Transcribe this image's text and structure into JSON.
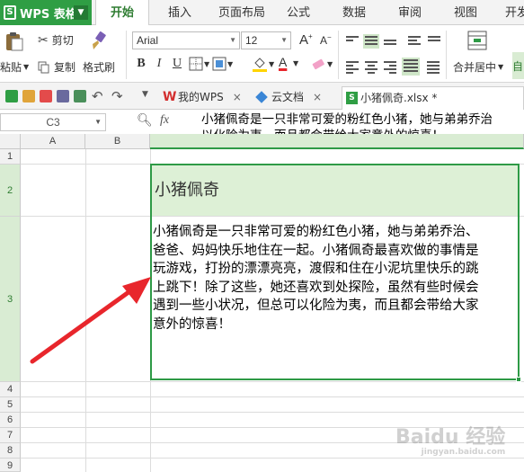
{
  "menubar": {
    "app_name": "WPS 表格",
    "app_logo": "S",
    "tabs": [
      "开始",
      "插入",
      "页面布局",
      "公式",
      "数据",
      "审阅",
      "视图",
      "开发"
    ]
  },
  "ribbon": {
    "paste_label": "粘贴",
    "cut_label": "剪切",
    "copy_label": "复制",
    "format_painter_label": "格式刷",
    "font_name": "Arial",
    "font_size": "12",
    "bold": "B",
    "italic": "I",
    "underline": "U",
    "font_color_letter": "A",
    "merge_label": "合并居中",
    "auto_label": "自"
  },
  "tabs_bar": {
    "tabs": [
      {
        "label": "我的WPS"
      },
      {
        "label": "云文档"
      },
      {
        "label": "小猪佩奇.xlsx *"
      }
    ],
    "close": "×"
  },
  "formula_bar": {
    "cell_ref": "C3",
    "fx": "fx",
    "lines": [
      "小猪佩奇是一只非常可爱的粉红色小猪，她与弟弟乔治",
      "以化险为夷，而且都会带给大家意外的惊喜！"
    ]
  },
  "sheet": {
    "columns": [
      "A",
      "B"
    ],
    "rows": [
      "1",
      "2",
      "3",
      "4",
      "5",
      "6",
      "7",
      "8",
      "9"
    ],
    "c2": "小猪佩奇",
    "c3_lines": [
      "小猪佩奇是一只非常可爱的粉红色小猪，她与弟弟乔治、",
      "爸爸、妈妈快乐地住在一起。小猪佩奇最喜欢做的事情是",
      "玩游戏，打扮的漂漂亮亮，渡假和住在小泥坑里快乐的跳",
      "上跳下！除了这些，她还喜欢到处探险，虽然有些时候会",
      "遇到一些小状况，但总可以化险为夷，而且都会带给大家",
      "意外的惊喜！"
    ]
  },
  "watermark": {
    "text": "Baidu 经验",
    "sub": "jingyan.baidu.com"
  },
  "colors": {
    "wps_green": "#2f9e44",
    "selection_green": "#2e9a46",
    "cell_fill": "#ddf0d6",
    "arrow_red": "#e8262c"
  }
}
